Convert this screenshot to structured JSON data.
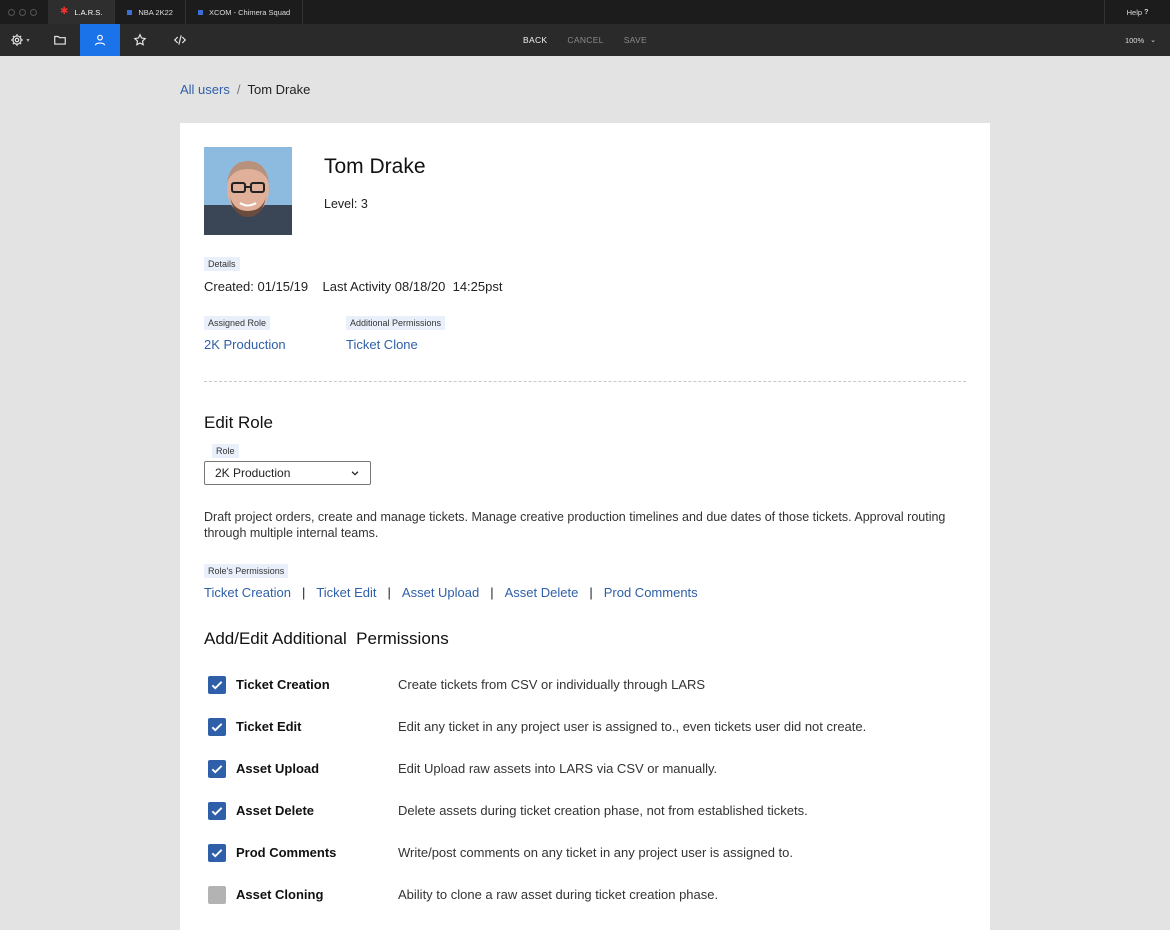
{
  "tabs": [
    {
      "label": "L.A.R.S.",
      "active": true
    },
    {
      "label": "NBA 2K22",
      "active": false
    },
    {
      "label": "XCOM - Chimera Squad",
      "active": false
    }
  ],
  "help_label": "Help",
  "toolbar": {
    "back": "BACK",
    "cancel": "CANCEL",
    "save": "SAVE",
    "zoom": "100%",
    "icons": [
      "gear-icon",
      "folder-icon",
      "user-icon",
      "star-icon",
      "code-icon"
    ]
  },
  "breadcrumb": {
    "root": "All users",
    "separator": "/",
    "current": "Tom Drake"
  },
  "profile": {
    "name": "Tom Drake",
    "level": "Level: 3",
    "details_tag": "Details",
    "details_line": "Created: 01/15/19    Last Activity 08/18/20  14:25pst",
    "assigned_role_tag": "Assigned Role",
    "assigned_role": "2K Production",
    "additional_permissions_tag": "Additional Permissions",
    "additional_permissions": "Ticket Clone"
  },
  "edit_role": {
    "heading": "Edit Role",
    "role_tag": "Role",
    "selected_role": "2K Production",
    "description": "Draft project orders, create and manage tickets. Manage creative production timelines and due dates of those tickets. Approval routing through multiple internal teams.",
    "role_permissions_tag": "Role's Permissions",
    "role_permissions": [
      "Ticket Creation",
      "Ticket Edit",
      "Asset Upload",
      "Asset Delete",
      "Prod Comments"
    ],
    "separator": "|"
  },
  "additional": {
    "heading": "Add/Edit Additional  Permissions",
    "permissions": [
      {
        "name": "Ticket Creation",
        "description": "Create tickets from CSV or individually through LARS",
        "checked": true
      },
      {
        "name": "Ticket Edit",
        "description": "Edit any ticket in any project user is assigned to., even tickets user did not create.",
        "checked": true
      },
      {
        "name": "Asset Upload",
        "description": "Edit Upload raw assets into LARS via CSV or manually.",
        "checked": true
      },
      {
        "name": "Asset Delete",
        "description": "Delete assets during ticket creation phase, not from established tickets.",
        "checked": true
      },
      {
        "name": "Prod Comments",
        "description": "Write/post comments on any ticket in any project user is assigned to.",
        "checked": true
      },
      {
        "name": "Asset Cloning",
        "description": "Ability to clone a raw asset during ticket creation phase.",
        "checked": false
      }
    ]
  },
  "colors": {
    "accent": "#1a73e8",
    "link": "#2f5fa8",
    "checkbox_on": "#2f5fa8",
    "checkbox_off": "#b3b3b3"
  }
}
